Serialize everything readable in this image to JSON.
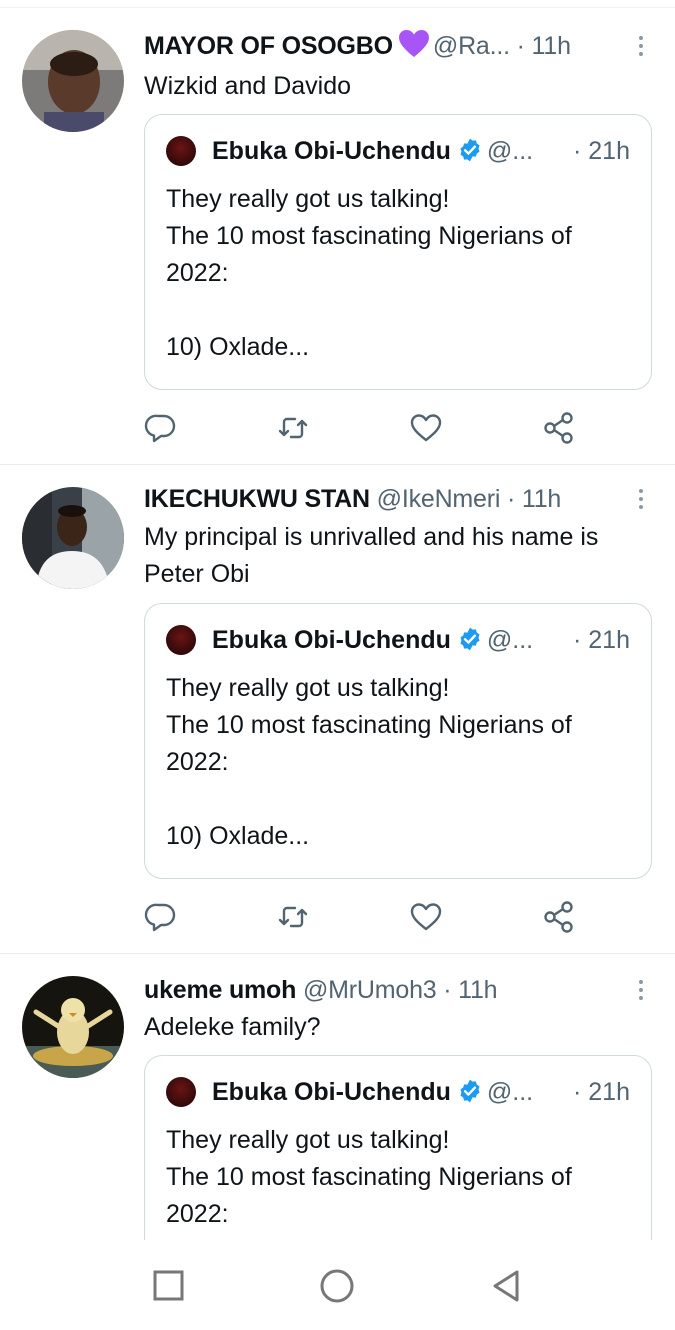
{
  "tweets": [
    {
      "author_name": "MAYOR OF OSOGBO",
      "name_emoji": "purple-heart-icon",
      "handle": "@Ra...",
      "time": "11h",
      "text": "Wizkid and Davido",
      "quote": {
        "author_name": "Ebuka Obi-Uchendu",
        "handle": "@...",
        "time": "21h",
        "text": "They really got us talking!\nThe 10 most fascinating Nigerians of 2022:\n\n10) Oxlade..."
      }
    },
    {
      "author_name": "IKECHUKWU STAN",
      "handle": "@IkeNmeri",
      "time": "11h",
      "text": "My principal is unrivalled and his name is Peter Obi",
      "quote": {
        "author_name": "Ebuka Obi-Uchendu",
        "handle": "@...",
        "time": "21h",
        "text": "They really got us talking!\nThe 10 most fascinating Nigerians of 2022:\n\n10) Oxlade..."
      }
    },
    {
      "author_name": "ukeme umoh",
      "handle": "@MrUmoh3",
      "time": "11h",
      "text": "Adeleke family?",
      "quote": {
        "author_name": "Ebuka Obi-Uchendu",
        "handle": "@...",
        "time": "21h",
        "text": "They really got us talking!\nThe 10 most fascinating Nigerians of 2022:"
      }
    }
  ],
  "separator": "·",
  "colors": {
    "text_primary": "#0f1419",
    "text_secondary": "#536471",
    "icon_gray": "#536471",
    "verified_blue": "#1d9bf0",
    "heart_purple": "#a855f7",
    "divider": "#e6ecf0"
  },
  "action_icons": [
    "reply-icon",
    "retweet-icon",
    "like-icon",
    "share-icon"
  ],
  "android_nav": [
    "recent-apps-icon",
    "home-icon",
    "back-icon"
  ]
}
